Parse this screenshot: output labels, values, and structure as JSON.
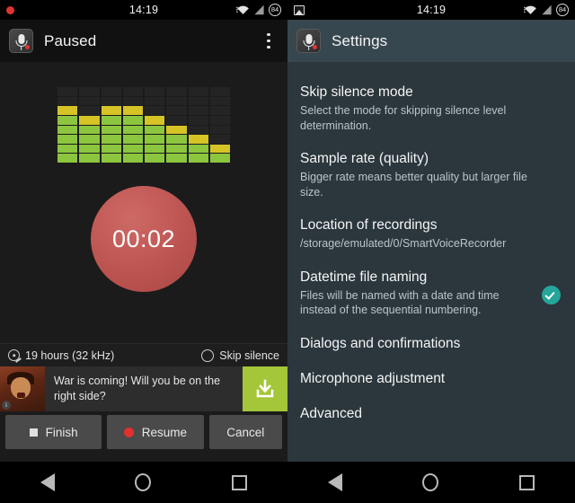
{
  "left": {
    "statusbar": {
      "recording_indicator": "record-dot",
      "clock": "14:19",
      "wifi": "wifi-icon",
      "signal": "signal-icon",
      "battery": "84"
    },
    "actionbar": {
      "app_icon": "microphone-app-icon",
      "title": "Paused",
      "overflow": "overflow-menu-icon"
    },
    "vu_meter": {
      "columns": 8,
      "rows": 8,
      "levels": [
        6,
        5,
        6,
        6,
        5,
        4,
        3,
        2
      ],
      "green_color": "#8cc63f",
      "yellow_color": "#d6c426",
      "empty_color": "#242424"
    },
    "timer": {
      "value": "00:02",
      "color": "#c25a57"
    },
    "info": {
      "storage_icon": "disc-icon",
      "capacity": "19 hours (32 kHz)",
      "skip_silence_label": "Skip silence",
      "skip_silence_checked": false
    },
    "ad": {
      "thumb": "ad-character-image",
      "info_badge": "i",
      "text": "War is coming! Will you be on the right side?",
      "cta_icon": "download-icon",
      "cta_color": "#a4c639"
    },
    "buttons": {
      "finish": "Finish",
      "finish_icon": "stop-icon",
      "resume": "Resume",
      "resume_icon": "record-icon",
      "cancel": "Cancel"
    },
    "navbar": {
      "back": "back-icon",
      "home": "home-icon",
      "recents": "recents-icon"
    }
  },
  "right": {
    "statusbar": {
      "screenshot_indicator": "image-icon",
      "clock": "14:19",
      "wifi": "wifi-icon",
      "signal": "signal-icon",
      "battery": "84"
    },
    "actionbar": {
      "app_icon": "microphone-app-icon",
      "title": "Settings",
      "background": "#37474f"
    },
    "settings_items": [
      {
        "title": "Skip silence mode",
        "summary": "Select the mode for skipping silence level determination.",
        "checked": null
      },
      {
        "title": "Sample rate (quality)",
        "summary": "Bigger rate means better quality but larger file size.",
        "checked": null
      },
      {
        "title": "Location of recordings",
        "summary": "/storage/emulated/0/SmartVoiceRecorder",
        "checked": null
      },
      {
        "title": "Datetime file naming",
        "summary": "Files will be named with a date and time instead of the sequential numbering.",
        "checked": true
      },
      {
        "title": "Dialogs and confirmations",
        "summary": "",
        "checked": null
      },
      {
        "title": "Microphone adjustment",
        "summary": "",
        "checked": null
      },
      {
        "title": "Advanced",
        "summary": "",
        "checked": null
      }
    ],
    "navbar": {
      "back": "back-icon",
      "home": "home-icon",
      "recents": "recents-icon"
    }
  }
}
